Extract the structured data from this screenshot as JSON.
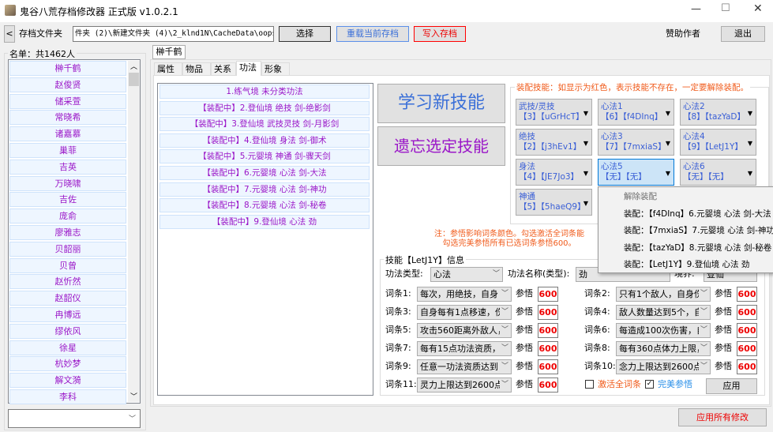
{
  "window": {
    "title": "鬼谷八荒存档修改器 正式版 v1.0.2.1",
    "min": "—",
    "max": "☐",
    "close": "✕"
  },
  "toolbar": {
    "back": "<",
    "folder_label": "存档文件夹",
    "folder_path": "件夹 (2)\\新建文件夹 (4)\\2_klnd1N\\CacheData\\oops",
    "choose": "选择",
    "reload": "重载当前存档",
    "write": "写入存档",
    "sponsor": "赞助作者",
    "exit": "退出"
  },
  "roster": {
    "title": "名单：共1462人",
    "names": [
      "榊千鹤",
      "赵俊贤",
      "储采萱",
      "常晓希",
      "诸嘉慕",
      "巢菲",
      "吉英",
      "万晓啸",
      "吉佐",
      "庞俞",
      "廖雅志",
      "贝韶丽",
      "贝曾",
      "赵忻然",
      "赵韶仪",
      "冉博远",
      "缪依风",
      "徐星",
      "杭妙梦",
      "解文漪",
      "李科"
    ],
    "search_value": ""
  },
  "character_tab": "榊千鹤",
  "tabs": [
    "属性",
    "物品",
    "关系",
    "功法",
    "形象"
  ],
  "active_tab": "功法",
  "skills": [
    "1.练气境  未分类功法",
    "【装配中】2.登仙境  绝技  剑-绝影剑",
    "【装配中】3.登仙境  武技灵技  剑-月影剑",
    "【装配中】4.登仙境  身法  剑-御术",
    "【装配中】5.元婴境  神通  剑-骤天剑",
    "【装配中】6.元婴境  心法  剑-大法",
    "【装配中】7.元婴境  心法  剑-神功",
    "【装配中】8.元婴境  心法  剑-秘卷",
    "【装配中】9.登仙境  心法  劲"
  ],
  "actions": {
    "learn": "学习新技能",
    "forget": "遗忘选定技能"
  },
  "equip": {
    "title": "装配技能：如显示为红色，表示技能不存在，一定要解除装配。",
    "slots": [
      {
        "name": "武技/灵技",
        "value": "【3】【uGrHcT】"
      },
      {
        "name": "心法1",
        "value": "【6】【f4DInq】"
      },
      {
        "name": "心法2",
        "value": "【8】【tazYaD】"
      },
      {
        "name": "绝技",
        "value": "【2】【j3hEv1】"
      },
      {
        "name": "心法3",
        "value": "【7】【7mxiaS】"
      },
      {
        "name": "心法4",
        "value": "【9】【LetJ1Y】"
      },
      {
        "name": "身法",
        "value": "【4】【JE7Jo3】"
      },
      {
        "name": "心法5",
        "value": "【无】【无】"
      },
      {
        "name": "心法6",
        "value": "【无】【无】"
      },
      {
        "name": "神通",
        "value": "【5】【5haeQ9】"
      }
    ]
  },
  "dropdown": {
    "items": [
      "解除装配",
      "装配：【f4DInq】6.元婴境 心法 剑-大法",
      "装配：【7mxiaS】7.元婴境 心法 剑-神功",
      "装配：【tazYaD】8.元婴境 心法 剑-秘卷",
      "装配：【LetJ1Y】9.登仙境 心法 劲"
    ]
  },
  "note": {
    "line1": "注：参悟影响词条颜色。勾选激活全词条能",
    "line2": "勾选完美参悟所有已选词条参悟600。"
  },
  "info": {
    "title": "技能【LetJ1Y】信息",
    "type_label": "功法类型:",
    "type_value": "心法",
    "name_label": "功法名称(类型):",
    "name_value": "劲",
    "realm_label": "境界:",
    "realm_value": "登仙",
    "insight_label": "参悟",
    "entries": [
      {
        "label": "词条1:",
        "value": "每次，用绝技，自身",
        "insight": "600"
      },
      {
        "label": "词条2:",
        "value": "只有1个敌人，自身伤",
        "insight": "600"
      },
      {
        "label": "词条3:",
        "value": "自身每有1点移速，伤",
        "insight": "600"
      },
      {
        "label": "词条4:",
        "value": "敌人数量达到5个，自",
        "insight": "600"
      },
      {
        "label": "词条5:",
        "value": "攻击560距离外敌人，",
        "insight": "600"
      },
      {
        "label": "词条6:",
        "value": "每造成100次伤害，自",
        "insight": "600"
      },
      {
        "label": "词条7:",
        "value": "每有15点功法资质，",
        "insight": "600"
      },
      {
        "label": "词条8:",
        "value": "每有360点体力上限，",
        "insight": "600"
      },
      {
        "label": "词条9:",
        "value": "任意一功法资质达到",
        "insight": "600"
      },
      {
        "label": "词条10:",
        "value": "念力上限达到2600点",
        "insight": "600"
      },
      {
        "label": "词条11:",
        "value": "灵力上限达到2600点",
        "insight": "600"
      }
    ],
    "activate_all": "激活全词条",
    "activate_all_checked": false,
    "perfect": "完美参悟",
    "perfect_checked": true,
    "apply": "应用"
  },
  "apply_all": "应用所有修改"
}
